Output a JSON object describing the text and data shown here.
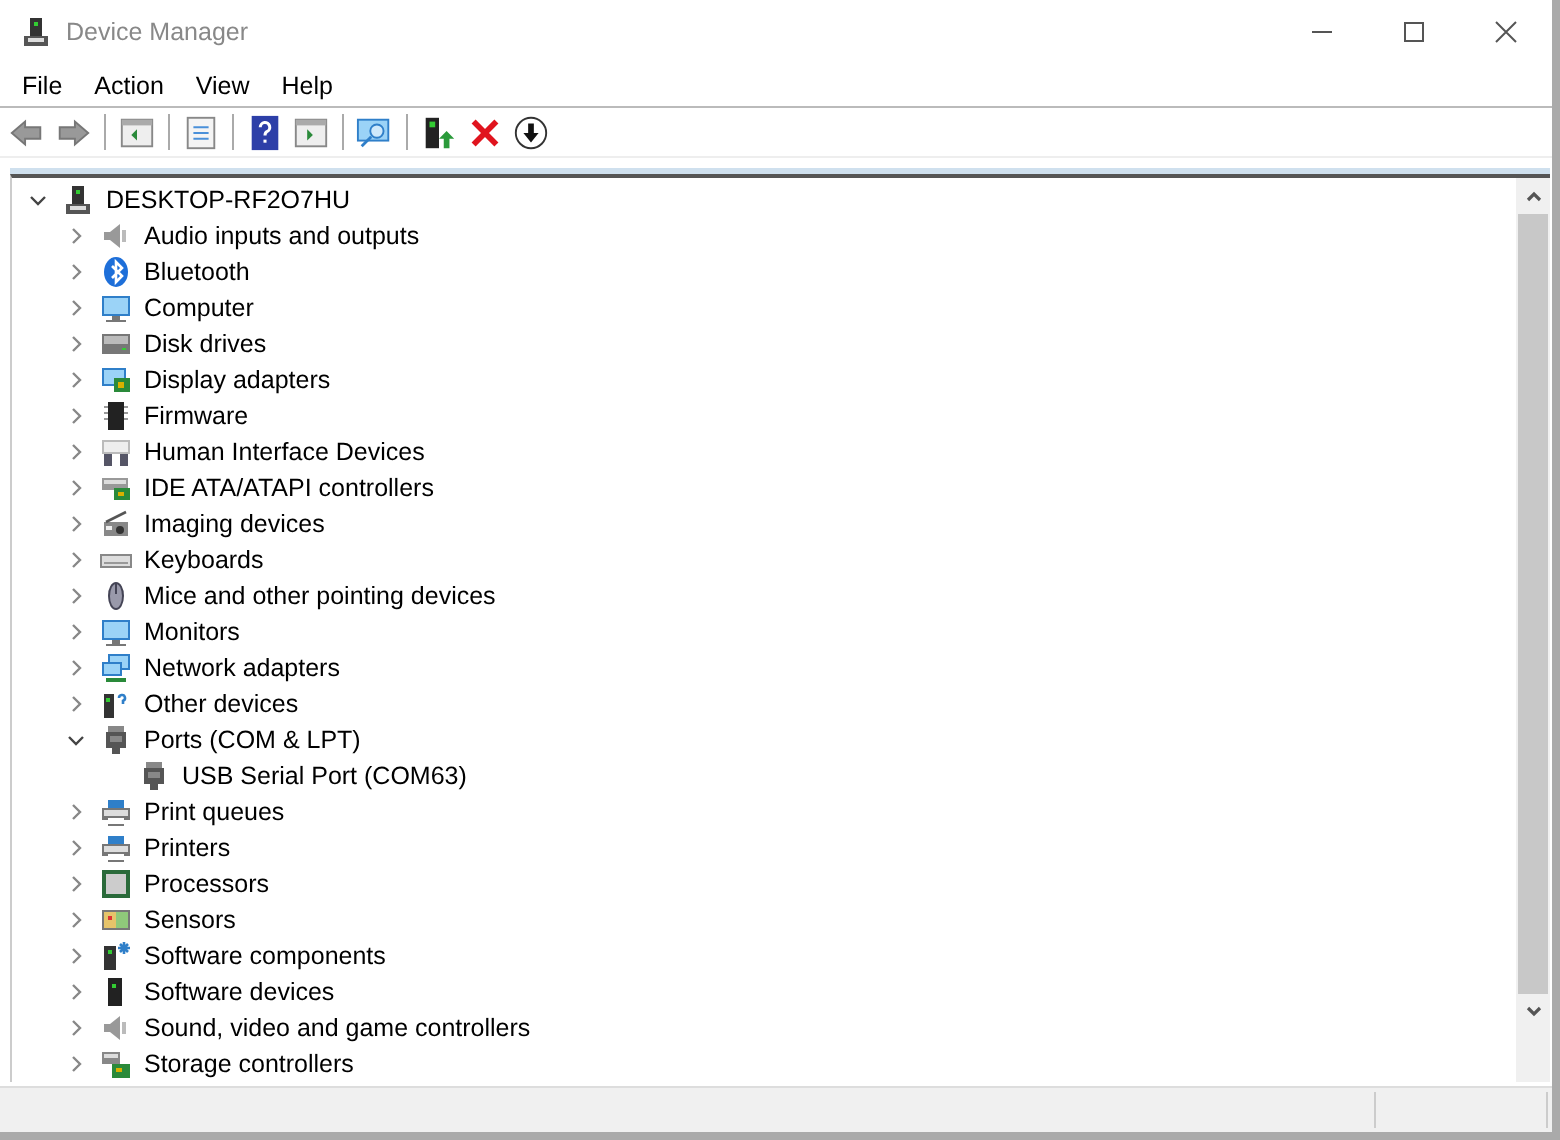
{
  "window": {
    "title": "Device Manager"
  },
  "menu": [
    {
      "label": "File"
    },
    {
      "label": "Action"
    },
    {
      "label": "View"
    },
    {
      "label": "Help"
    }
  ],
  "tree": {
    "label": "DESKTOP-RF2O7HU",
    "kind": "host",
    "expanded": true,
    "children": [
      {
        "label": "Audio inputs and outputs",
        "kind": "speaker",
        "expanded": false
      },
      {
        "label": "Bluetooth",
        "kind": "bluetooth",
        "expanded": false
      },
      {
        "label": "Computer",
        "kind": "monitor",
        "expanded": false
      },
      {
        "label": "Disk drives",
        "kind": "disk",
        "expanded": false
      },
      {
        "label": "Display adapters",
        "kind": "display",
        "expanded": false
      },
      {
        "label": "Firmware",
        "kind": "chip",
        "expanded": false
      },
      {
        "label": "Human Interface Devices",
        "kind": "hid",
        "expanded": false
      },
      {
        "label": "IDE ATA/ATAPI controllers",
        "kind": "controller",
        "expanded": false
      },
      {
        "label": "Imaging devices",
        "kind": "camera",
        "expanded": false
      },
      {
        "label": "Keyboards",
        "kind": "keyboard",
        "expanded": false
      },
      {
        "label": "Mice and other pointing devices",
        "kind": "mouse",
        "expanded": false
      },
      {
        "label": "Monitors",
        "kind": "monitor",
        "expanded": false
      },
      {
        "label": "Network adapters",
        "kind": "network",
        "expanded": false
      },
      {
        "label": "Other devices",
        "kind": "unknown",
        "expanded": false
      },
      {
        "label": "Ports (COM & LPT)",
        "kind": "port",
        "expanded": true,
        "children": [
          {
            "label": "USB Serial Port (COM63)",
            "kind": "port"
          }
        ]
      },
      {
        "label": "Print queues",
        "kind": "printer",
        "expanded": false
      },
      {
        "label": "Printers",
        "kind": "printer",
        "expanded": false
      },
      {
        "label": "Processors",
        "kind": "processor",
        "expanded": false
      },
      {
        "label": "Sensors",
        "kind": "sensor",
        "expanded": false
      },
      {
        "label": "Software components",
        "kind": "component",
        "expanded": false
      },
      {
        "label": "Software devices",
        "kind": "tower",
        "expanded": false
      },
      {
        "label": "Sound, video and game controllers",
        "kind": "speaker",
        "expanded": false
      },
      {
        "label": "Storage controllers",
        "kind": "storage",
        "expanded": false
      }
    ]
  }
}
